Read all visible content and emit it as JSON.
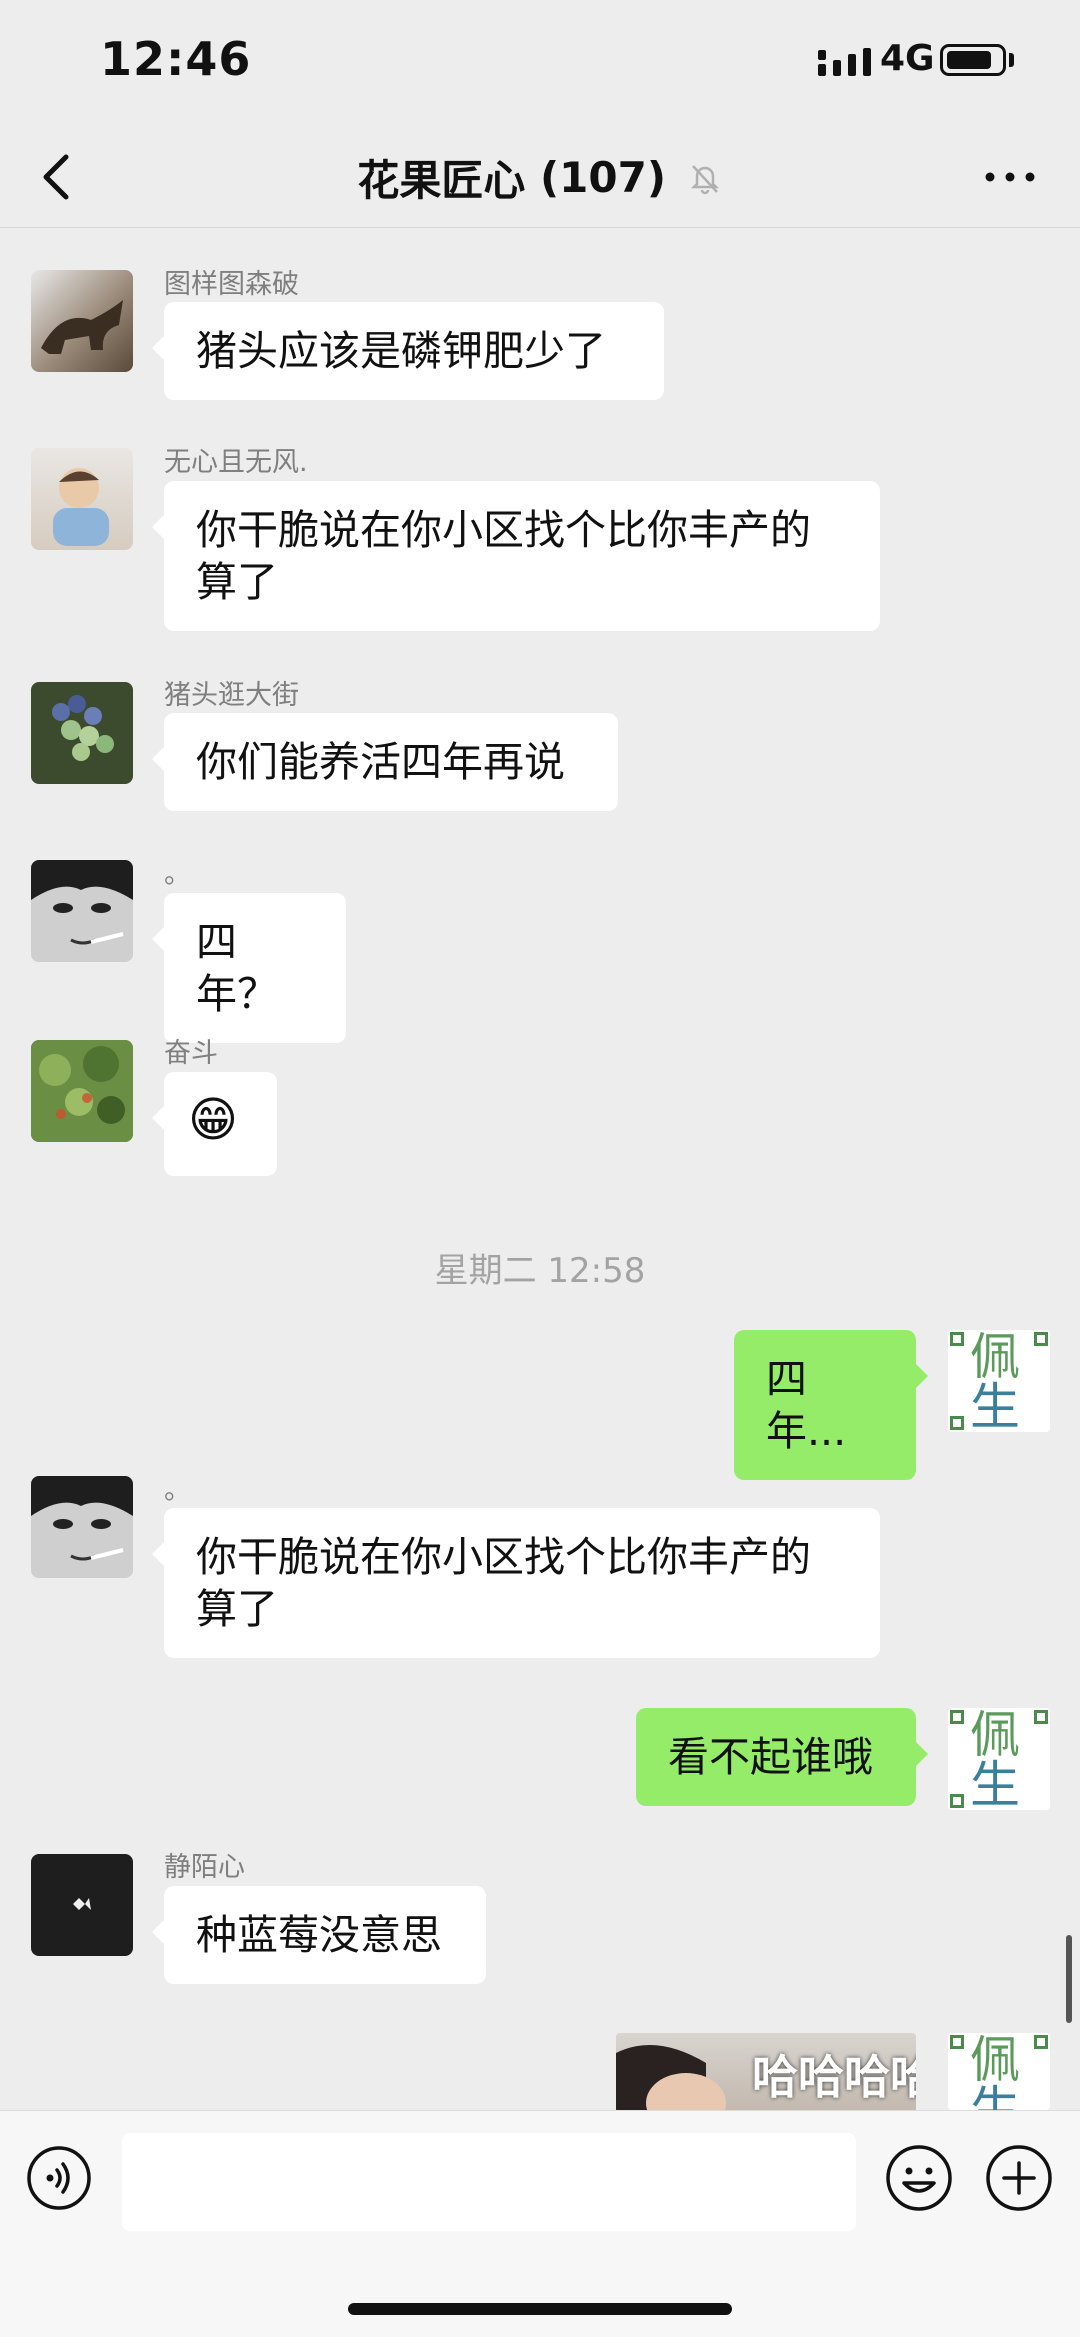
{
  "status_bar": {
    "time": "12:46",
    "network": "4G"
  },
  "header": {
    "title": "花果匠心",
    "member_count": "(107)"
  },
  "messages": [
    {
      "sender": "图样图森破",
      "text": "猪头应该是磷钾肥少了"
    },
    {
      "sender": "无心且无风.",
      "text": "你干脆说在你小区找个比你丰产的算了"
    },
    {
      "sender": "猪头逛大街",
      "text": "你们能养活四年再说"
    },
    {
      "sender": "。",
      "text": "四年？"
    },
    {
      "sender": "奋斗",
      "text": "😁"
    },
    {
      "timestamp": "星期二 12:58"
    },
    {
      "self": true,
      "text": "四年..."
    },
    {
      "sender": "。",
      "text": "你干脆说在你小区找个比你丰产的算了"
    },
    {
      "self": true,
      "text": "看不起谁哦"
    },
    {
      "sender": "静陌心",
      "text": "种蓝莓没意思"
    },
    {
      "self": true,
      "image_caption": "哈哈哈哈"
    }
  ],
  "self_avatar": {
    "char1": "佩",
    "char2": "生"
  },
  "input": {
    "placeholder": ""
  },
  "colors": {
    "background": "#ededed",
    "self_bubble": "#95ec69",
    "other_bubble": "#ffffff"
  }
}
